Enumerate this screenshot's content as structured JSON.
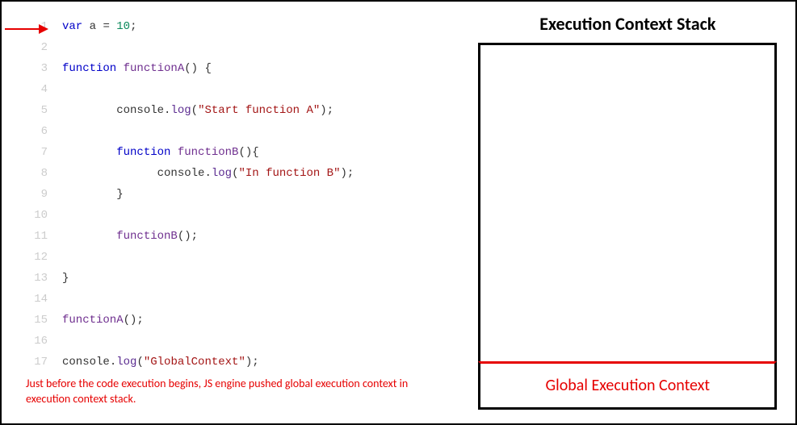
{
  "code": {
    "lines": [
      {
        "n": "1",
        "tokens": [
          [
            "kw",
            "var"
          ],
          [
            "name",
            " a "
          ],
          [
            "op",
            "="
          ],
          [
            "num",
            " 10"
          ],
          [
            "op",
            ";"
          ]
        ]
      },
      {
        "n": "2",
        "tokens": []
      },
      {
        "n": "3",
        "tokens": [
          [
            "kw",
            "function"
          ],
          [
            "fn",
            " functionA"
          ],
          [
            "op",
            "() {"
          ]
        ]
      },
      {
        "n": "4",
        "tokens": []
      },
      {
        "n": "5",
        "tokens": [
          [
            "name",
            "        console"
          ],
          [
            "op",
            "."
          ],
          [
            "method",
            "log"
          ],
          [
            "op",
            "("
          ],
          [
            "str",
            "\"Start function A\""
          ],
          [
            "op",
            ");"
          ]
        ]
      },
      {
        "n": "6",
        "tokens": []
      },
      {
        "n": "7",
        "tokens": [
          [
            "name",
            "        "
          ],
          [
            "kw",
            "function"
          ],
          [
            "fn",
            " functionB"
          ],
          [
            "op",
            "(){"
          ]
        ]
      },
      {
        "n": "8",
        "tokens": [
          [
            "name",
            "              console"
          ],
          [
            "op",
            "."
          ],
          [
            "method",
            "log"
          ],
          [
            "op",
            "("
          ],
          [
            "str",
            "\"In function B\""
          ],
          [
            "op",
            ");"
          ]
        ]
      },
      {
        "n": "9",
        "tokens": [
          [
            "op",
            "        }"
          ]
        ]
      },
      {
        "n": "10",
        "tokens": []
      },
      {
        "n": "11",
        "tokens": [
          [
            "fn",
            "        functionB"
          ],
          [
            "op",
            "();"
          ]
        ]
      },
      {
        "n": "12",
        "tokens": []
      },
      {
        "n": "13",
        "tokens": [
          [
            "op",
            "}"
          ]
        ]
      },
      {
        "n": "14",
        "tokens": []
      },
      {
        "n": "15",
        "tokens": [
          [
            "fn",
            "functionA"
          ],
          [
            "op",
            "();"
          ]
        ]
      },
      {
        "n": "16",
        "tokens": []
      },
      {
        "n": "17",
        "tokens": [
          [
            "name",
            "console"
          ],
          [
            "op",
            "."
          ],
          [
            "method",
            "log"
          ],
          [
            "op",
            "("
          ],
          [
            "str",
            "\"GlobalContext\""
          ],
          [
            "op",
            ");"
          ]
        ]
      }
    ],
    "current_line_index": 0
  },
  "caption": "Just before the code execution begins, JS engine pushed global execution context in execution context stack.",
  "stack": {
    "title": "Execution Context Stack",
    "items": [
      "Global Execution Context"
    ]
  }
}
